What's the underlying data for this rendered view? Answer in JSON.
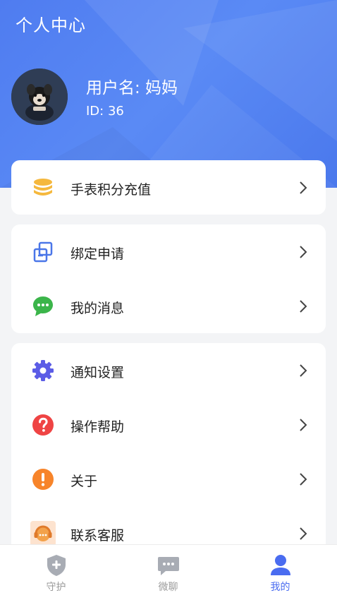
{
  "header": {
    "title": "个人中心",
    "username": "用户名: 妈妈",
    "user_id": "ID: 36"
  },
  "colors": {
    "header_blue": "#4f7cf0",
    "accent": "#4a6cf0",
    "coin_yellow": "#f5b83d",
    "bind_blue": "#4a76e8",
    "message_green": "#3bb54a",
    "gear_purple": "#5b5ce6",
    "help_red": "#ef4444",
    "about_orange": "#f7842a",
    "service_orange": "#f3a24b"
  },
  "menu": {
    "recharge": {
      "label": "手表积分充值",
      "icon": "coin-stack-icon"
    },
    "bind": {
      "label": "绑定申请",
      "icon": "link-squares-icon"
    },
    "messages": {
      "label": "我的消息",
      "icon": "chat-bubble-icon"
    },
    "notify": {
      "label": "通知设置",
      "icon": "gear-icon"
    },
    "help": {
      "label": "操作帮助",
      "icon": "question-icon"
    },
    "about": {
      "label": "关于",
      "icon": "exclamation-icon"
    },
    "service": {
      "label": "联系客服",
      "icon": "headset-icon"
    }
  },
  "tabs": [
    {
      "label": "守护",
      "icon": "shield-plus-icon"
    },
    {
      "label": "微聊",
      "icon": "chat-icon"
    },
    {
      "label": "我的",
      "icon": "person-icon"
    }
  ]
}
